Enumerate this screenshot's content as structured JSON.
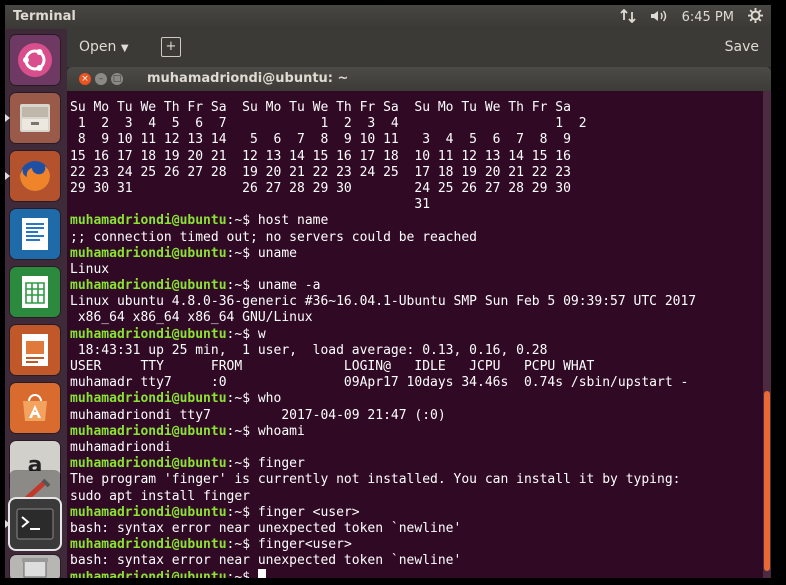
{
  "topbar": {
    "app_title": "Terminal",
    "tray": {
      "network_icon": "network-arrows-icon",
      "sound_icon": "volume-icon",
      "clock": "6:45 PM",
      "settings_icon": "gear-icon"
    }
  },
  "editor": {
    "open_label": "Open",
    "save_label": "Save"
  },
  "terminal": {
    "title": "muhamadriondi@ubuntu: ~",
    "prompt_user": "muhamadriondi@ubuntu",
    "prompt_suffix": ":~$ ",
    "lines": [
      {
        "t": "out",
        "v": "Su Mo Tu We Th Fr Sa  Su Mo Tu We Th Fr Sa  Su Mo Tu We Th Fr Sa"
      },
      {
        "t": "out",
        "v": " 1  2  3  4  5  6  7            1  2  3  4                    1  2"
      },
      {
        "t": "out",
        "v": " 8  9 10 11 12 13 14   5  6  7  8  9 10 11   3  4  5  6  7  8  9"
      },
      {
        "t": "out",
        "v": "15 16 17 18 19 20 21  12 13 14 15 16 17 18  10 11 12 13 14 15 16"
      },
      {
        "t": "out",
        "v": "22 23 24 25 26 27 28  19 20 21 22 23 24 25  17 18 19 20 21 22 23"
      },
      {
        "t": "out",
        "v": "29 30 31              26 27 28 29 30        24 25 26 27 28 29 30"
      },
      {
        "t": "out",
        "v": "                                            31"
      },
      {
        "t": "cmd",
        "v": "host name"
      },
      {
        "t": "out",
        "v": ";; connection timed out; no servers could be reached"
      },
      {
        "t": "cmd",
        "v": "uname"
      },
      {
        "t": "out",
        "v": "Linux"
      },
      {
        "t": "cmd",
        "v": "uname -a"
      },
      {
        "t": "out",
        "v": "Linux ubuntu 4.8.0-36-generic #36~16.04.1-Ubuntu SMP Sun Feb 5 09:39:57 UTC 2017"
      },
      {
        "t": "out",
        "v": " x86_64 x86_64 x86_64 GNU/Linux"
      },
      {
        "t": "cmd",
        "v": "w"
      },
      {
        "t": "out",
        "v": " 18:43:31 up 25 min,  1 user,  load average: 0.13, 0.16, 0.28"
      },
      {
        "t": "out",
        "v": "USER     TTY      FROM             LOGIN@   IDLE   JCPU   PCPU WHAT"
      },
      {
        "t": "out",
        "v": "muhamadr tty7     :0               09Apr17 10days 34.46s  0.74s /sbin/upstart -"
      },
      {
        "t": "cmd",
        "v": "who"
      },
      {
        "t": "out",
        "v": "muhamadriondi tty7         2017-04-09 21:47 (:0)"
      },
      {
        "t": "cmd",
        "v": "whoami"
      },
      {
        "t": "out",
        "v": "muhamadriondi"
      },
      {
        "t": "cmd",
        "v": "finger"
      },
      {
        "t": "out",
        "v": "The program 'finger' is currently not installed. You can install it by typing:"
      },
      {
        "t": "out",
        "v": "sudo apt install finger"
      },
      {
        "t": "cmd",
        "v": "finger <user>"
      },
      {
        "t": "out",
        "v": "bash: syntax error near unexpected token `newline'"
      },
      {
        "t": "cmd",
        "v": "finger<user>"
      },
      {
        "t": "out",
        "v": "bash: syntax error near unexpected token `newline'"
      },
      {
        "t": "cmd",
        "v": ""
      }
    ]
  },
  "launcher": {
    "items": [
      {
        "name": "ubuntu-dash-icon"
      },
      {
        "name": "files-icon"
      },
      {
        "name": "firefox-icon"
      },
      {
        "name": "libreoffice-writer-icon"
      },
      {
        "name": "libreoffice-calc-icon"
      },
      {
        "name": "libreoffice-impress-icon"
      },
      {
        "name": "software-center-icon"
      },
      {
        "name": "amazon-icon"
      },
      {
        "name": "system-settings-icon"
      },
      {
        "name": "terminal-icon"
      },
      {
        "name": "trash-icon"
      }
    ]
  },
  "colors": {
    "terminal_bg": "#300a24",
    "prompt_green": "#8ae234",
    "accent_orange": "#e96a35"
  }
}
